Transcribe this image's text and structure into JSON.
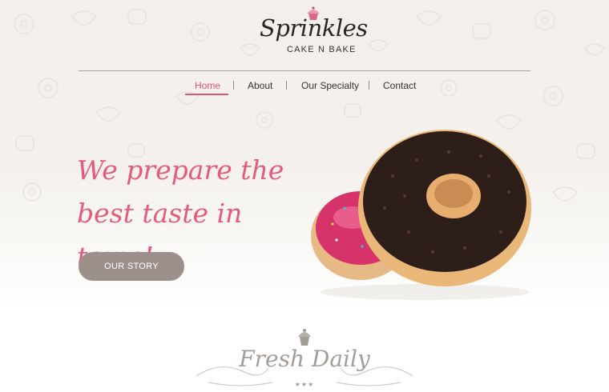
{
  "brand": {
    "name": "Sprinkles",
    "tagline": "CAKE N BAKE"
  },
  "nav": {
    "items": [
      {
        "label": "Home",
        "active": true
      },
      {
        "label": "About",
        "active": false
      },
      {
        "label": "Our Specialty",
        "active": false
      },
      {
        "label": "Contact",
        "active": false
      }
    ]
  },
  "hero": {
    "headline_line1": "We prepare the",
    "headline_line2": "best taste in town!",
    "cta_label": "OUR STORY"
  },
  "section": {
    "title": "Fresh Daily",
    "stars": "★★★"
  },
  "colors": {
    "accent": "#e05477",
    "headline": "#e45b7c",
    "button": "#9b918a",
    "muted": "#a39d98"
  }
}
